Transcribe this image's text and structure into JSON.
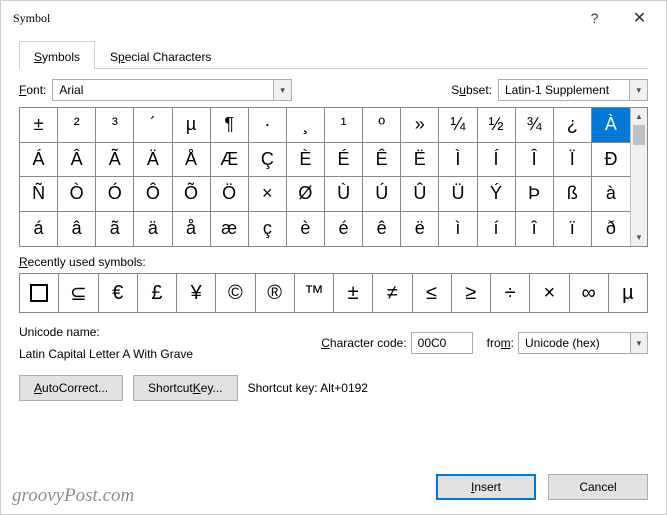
{
  "title": "Symbol",
  "tabs": {
    "symbols": "Symbols",
    "special": "Special Characters"
  },
  "font": {
    "label": "Font:",
    "value": "Arial"
  },
  "subset": {
    "label": "Subset:",
    "value": "Latin-1 Supplement"
  },
  "grid": [
    "±",
    "²",
    "³",
    "´",
    "µ",
    "¶",
    "·",
    "¸",
    "¹",
    "º",
    "»",
    "¼",
    "½",
    "¾",
    "¿",
    "À",
    "Á",
    "Â",
    "Ã",
    "Ä",
    "Å",
    "Æ",
    "Ç",
    "È",
    "É",
    "Ê",
    "Ë",
    "Ì",
    "Í",
    "Î",
    "Ï",
    "Ð",
    "Ñ",
    "Ò",
    "Ó",
    "Ô",
    "Õ",
    "Ö",
    "×",
    "Ø",
    "Ù",
    "Ú",
    "Û",
    "Ü",
    "Ý",
    "Þ",
    "ß",
    "à",
    "á",
    "â",
    "ã",
    "ä",
    "å",
    "æ",
    "ç",
    "è",
    "é",
    "ê",
    "ë",
    "ì",
    "í",
    "î",
    "ï",
    "ð"
  ],
  "selected_index": 15,
  "recent_label": "Recently used symbols:",
  "recent": [
    "□",
    "⊆",
    "€",
    "£",
    "¥",
    "©",
    "®",
    "™",
    "±",
    "≠",
    "≤",
    "≥",
    "÷",
    "×",
    "∞",
    "µ"
  ],
  "unicode_name_label": "Unicode name:",
  "unicode_name": "Latin Capital Letter A With Grave",
  "char_code_label": "Character code:",
  "char_code": "00C0",
  "from_label": "from:",
  "from_value": "Unicode (hex)",
  "autocorrect_btn": "AutoCorrect...",
  "shortcut_btn": "Shortcut Key...",
  "shortcut_text": "Shortcut key: Alt+0192",
  "insert_btn": "Insert",
  "cancel_btn": "Cancel",
  "watermark": "groovyPost.com"
}
